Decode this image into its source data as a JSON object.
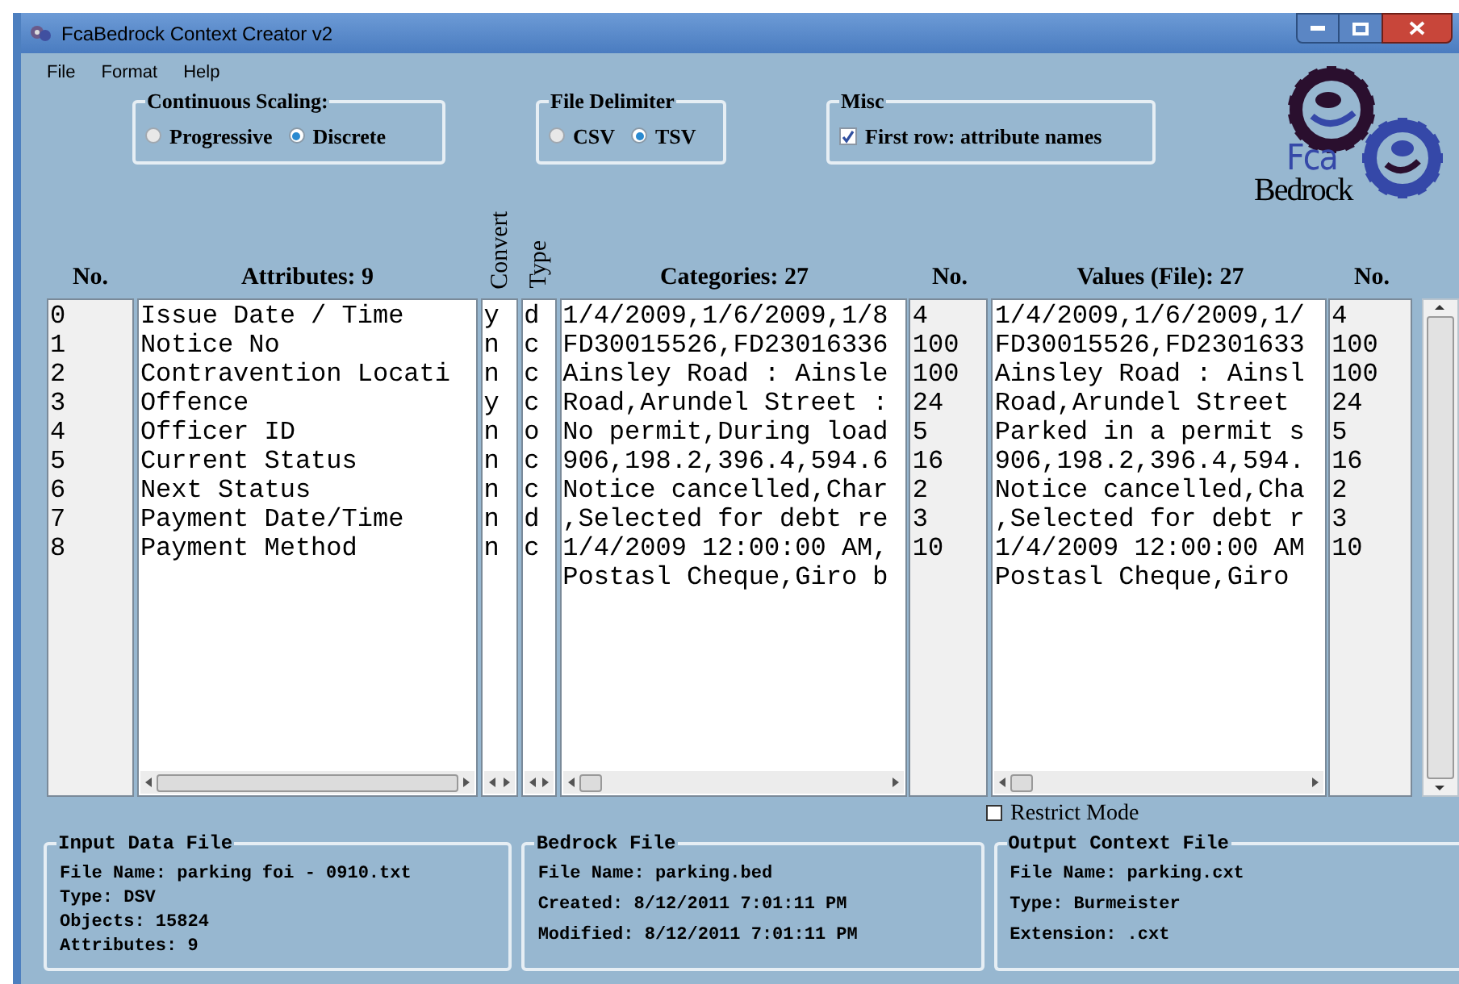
{
  "window": {
    "title": "FcaBedrock Context Creator v2"
  },
  "menu": [
    "File",
    "Format",
    "Help"
  ],
  "continuous_scaling": {
    "title": "Continuous Scaling:",
    "options": [
      {
        "label": "Progressive",
        "selected": false
      },
      {
        "label": "Discrete",
        "selected": true
      }
    ]
  },
  "file_delimiter": {
    "title": "File Delimiter",
    "options": [
      {
        "label": "CSV",
        "selected": false
      },
      {
        "label": "TSV",
        "selected": true
      }
    ]
  },
  "misc": {
    "title": "Misc",
    "checkbox": {
      "label": "First row: attribute names",
      "checked": true
    }
  },
  "logo": {
    "line_1": "Fca",
    "line_2": "Bedrock"
  },
  "headers": [
    "No.",
    "Attributes: 9",
    "Convert",
    "Type",
    "Categories: 27",
    "No.",
    "Values (File): 27",
    "No."
  ],
  "attributes": [
    {
      "no": "0",
      "name": "Issue Date / Time",
      "convert": "y",
      "type": "d"
    },
    {
      "no": "1",
      "name": "Notice No",
      "convert": "n",
      "type": "c"
    },
    {
      "no": "2",
      "name": "Contravention Locati",
      "convert": "n",
      "type": "c"
    },
    {
      "no": "3",
      "name": "Offence",
      "convert": "y",
      "type": "c"
    },
    {
      "no": "4",
      "name": "Officer ID",
      "convert": "n",
      "type": "o"
    },
    {
      "no": "5",
      "name": "Current Status",
      "convert": "n",
      "type": "c"
    },
    {
      "no": "6",
      "name": "Next Status",
      "convert": "n",
      "type": "c"
    },
    {
      "no": "7",
      "name": "Payment Date/Time",
      "convert": "n",
      "type": "d"
    },
    {
      "no": "8",
      "name": "Payment Method",
      "convert": "n",
      "type": "c"
    }
  ],
  "categories": [
    {
      "text": "1/4/2009,1/6/2009,1/8",
      "count": "4"
    },
    {
      "text": "FD30015526,FD23016336",
      "count": "100"
    },
    {
      "text": "Ainsley Road : Ainsle",
      "count": "100"
    },
    {
      "text": "Road,Arundel Street :",
      "count": "24"
    },
    {
      "text": "No permit,During load",
      "count": "5"
    },
    {
      "text": "906,198.2,396.4,594.6",
      "count": "16"
    },
    {
      "text": "Notice cancelled,Char",
      "count": "2"
    },
    {
      "text": ",Selected for debt re",
      "count": "3"
    },
    {
      "text": "1/4/2009 12:00:00 AM,",
      "count": "10"
    },
    {
      "text": "Postasl Cheque,Giro b"
    }
  ],
  "values": [
    {
      "text": "1/4/2009,1/6/2009,1/",
      "count": "4"
    },
    {
      "text": "FD30015526,FD2301633",
      "count": "100"
    },
    {
      "text": "Ainsley Road : Ainsl",
      "count": "100"
    },
    {
      "text": "Road,Arundel Street",
      "count": "24"
    },
    {
      "text": "Parked in a permit s",
      "count": "5"
    },
    {
      "text": "906,198.2,396.4,594.",
      "count": "16"
    },
    {
      "text": "Notice cancelled,Cha",
      "count": "2"
    },
    {
      "text": ",Selected for debt r",
      "count": "3"
    },
    {
      "text": "1/4/2009 12:00:00 AM",
      "count": "10"
    },
    {
      "text": "Postasl Cheque,Giro"
    }
  ],
  "restrict_mode": {
    "label": "Restrict Mode",
    "checked": false
  },
  "panels": [
    {
      "title": "Input Data File",
      "lines": [
        "File Name: parking foi - 0910.txt",
        "Type: DSV",
        "Objects: 15824",
        "Attributes: 9"
      ]
    },
    {
      "title": "Bedrock File",
      "lines": [
        "File Name: parking.bed",
        "Created: 8/12/2011 7:01:11 PM",
        "Modified: 8/12/2011 7:01:11 PM"
      ]
    },
    {
      "title": "Output Context File",
      "lines": [
        "File Name: parking.cxt",
        "Type: Burmeister",
        "Extension: .cxt"
      ]
    }
  ]
}
